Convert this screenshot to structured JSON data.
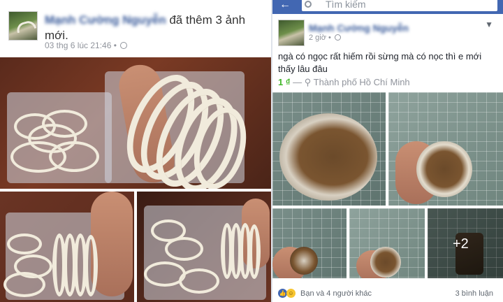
{
  "left_post": {
    "author": "Mạnh Cường Nguyễn",
    "action": " đã thêm 3 ảnh mới.",
    "timestamp": "03 thg 6 lúc 21:46 •",
    "icons": {
      "privacy": "globe-icon"
    }
  },
  "right_post": {
    "search_placeholder": "Tìm kiếm",
    "author": "Mạnh Cường Nguyễn",
    "time": "2 giờ •",
    "text": "ngà có ngọc rất hiếm rồi sừng mà có nọc thì e mới thấy lâu đâu",
    "price": "1 ₫",
    "location": " — ⚲ Thành phố Hồ Chí Minh",
    "more_photos": "+2",
    "reactions": "Bạn và 4 người khác",
    "comments": "3 bình luận",
    "icons": {
      "back": "back-arrow-icon",
      "search": "search-icon",
      "menu": "chevron-down-icon",
      "like": "like-icon",
      "haha": "haha-icon"
    }
  }
}
